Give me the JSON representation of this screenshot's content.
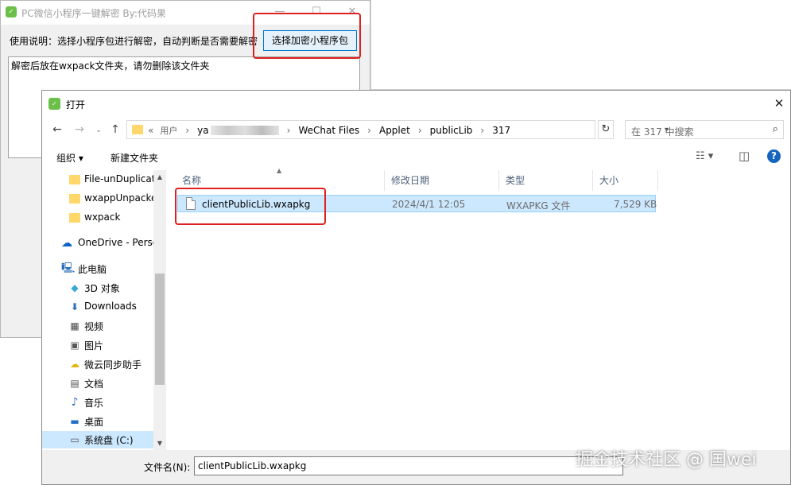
{
  "app_window": {
    "icon": "wechat-mini-program-icon",
    "title": "PC微信小程序一键解密 By:代码果",
    "instruction": "使用说明：选择小程序包进行解密，自动判断是否需要解密",
    "select_button": "选择加密小程序包",
    "log_text": "解密后放在wxpack文件夹，请勿删除该文件夹",
    "min_glyph": "—",
    "max_glyph": "☐",
    "close_glyph": "✕"
  },
  "dialog": {
    "title": "打开",
    "close_glyph": "✕",
    "breadcrumb": {
      "overflow": "«",
      "items": [
        "用户",
        "ya",
        "WeChat Files",
        "Applet",
        "publicLib",
        "317"
      ],
      "sep": "›"
    },
    "search_placeholder": "在 317 中搜索",
    "toolbar": {
      "organize": "组织 ▾",
      "new_folder": "新建文件夹",
      "view_glyph": "☷ ▾",
      "pane_glyph": "◫",
      "help_glyph": "?"
    },
    "nav_pane": [
      {
        "label": "File-unDuplicat",
        "icon": "folder-icon"
      },
      {
        "label": "wxappUnpacke",
        "icon": "folder-icon"
      },
      {
        "label": "wxpack",
        "icon": "folder-icon"
      },
      {
        "label": "OneDrive - Perso",
        "icon": "cloud-icon"
      },
      {
        "label": "此电脑",
        "icon": "computer-icon"
      },
      {
        "label": "3D 对象",
        "icon": "cube-icon"
      },
      {
        "label": "Downloads",
        "icon": "download-icon"
      },
      {
        "label": "视频",
        "icon": "video-icon"
      },
      {
        "label": "图片",
        "icon": "picture-icon"
      },
      {
        "label": "微云同步助手",
        "icon": "weiyun-icon"
      },
      {
        "label": "文档",
        "icon": "document-icon"
      },
      {
        "label": "音乐",
        "icon": "music-icon"
      },
      {
        "label": "桌面",
        "icon": "desktop-icon"
      },
      {
        "label": "系统盘 (C:)",
        "icon": "drive-icon"
      }
    ],
    "columns": [
      "名称",
      "修改日期",
      "类型",
      "大小"
    ],
    "files": [
      {
        "name": "clientPublicLib.wxapkg",
        "date": "2024/4/1 12:05",
        "type": "WXAPKG 文件",
        "size": "7,529 KB"
      }
    ],
    "filename_label": "文件名(N):",
    "filename_value": "clientPublicLib.wxapkg"
  },
  "watermark": "掘金技术社区 @ 国wei"
}
